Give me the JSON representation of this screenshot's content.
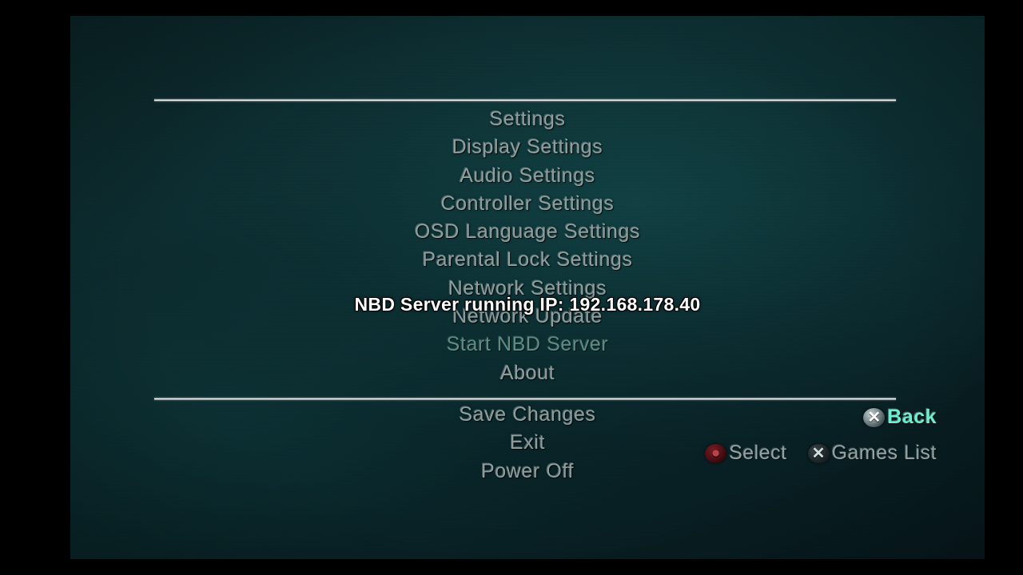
{
  "screen": {
    "title": "Settings",
    "background_color": "#0b2a2d",
    "letterbox_color": "#000000"
  },
  "menu": {
    "items": [
      {
        "label": "Settings",
        "state": "normal"
      },
      {
        "label": "Display Settings",
        "state": "normal"
      },
      {
        "label": "Audio Settings",
        "state": "normal"
      },
      {
        "label": "Controller Settings",
        "state": "normal"
      },
      {
        "label": "OSD Language Settings",
        "state": "normal"
      },
      {
        "label": "Parental Lock Settings",
        "state": "normal"
      },
      {
        "label": "Network Settings",
        "state": "normal"
      },
      {
        "label": "Network Update",
        "state": "normal"
      },
      {
        "label": "Start NBD Server",
        "state": "dim"
      },
      {
        "label": "About",
        "state": "normal"
      }
    ],
    "footer_items": [
      {
        "label": "Save Changes",
        "state": "normal"
      },
      {
        "label": "Exit",
        "state": "normal"
      },
      {
        "label": "Power Off",
        "state": "normal"
      }
    ]
  },
  "status_overlay": {
    "text": "NBD Server running IP: 192.168.178.40",
    "color": "#ffffff"
  },
  "hints": {
    "primary": {
      "icon": "cross-button-icon",
      "glyph": "✕",
      "label": "Back",
      "color": "#6ff0d2"
    },
    "secondary": [
      {
        "icon": "circle-button-icon",
        "glyph": "●",
        "label": "Select",
        "color": "#93a4a5"
      },
      {
        "icon": "cross-button-icon",
        "glyph": "✕",
        "label": "Games List",
        "color": "#93a4a5"
      }
    ]
  }
}
